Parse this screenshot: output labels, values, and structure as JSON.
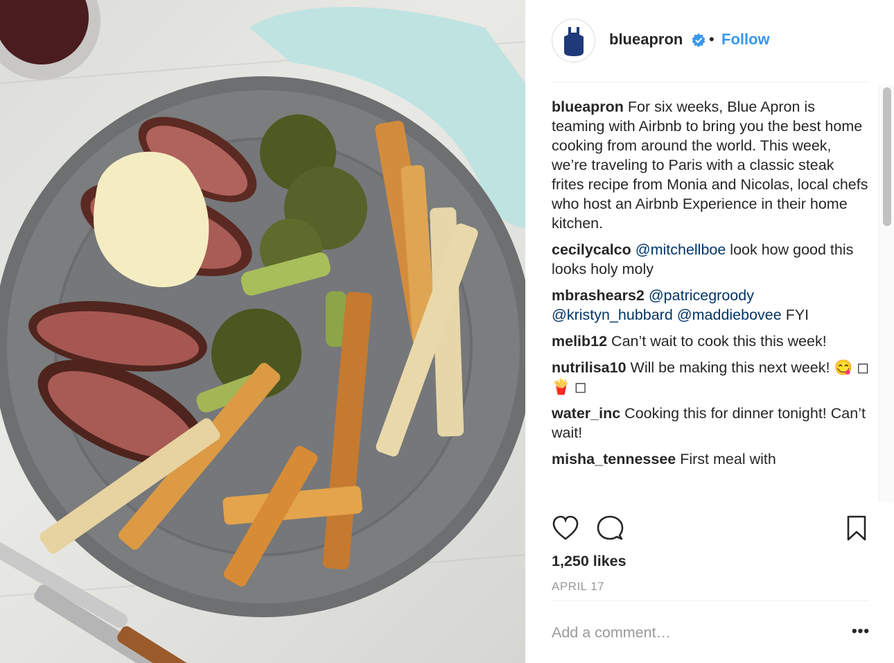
{
  "post": {
    "handle": "blueapron",
    "follow_label": "Follow",
    "separator": "•",
    "brand_color": "#1e3a78",
    "verified_color": "#3897f0"
  },
  "comments": [
    {
      "user": "blueapron",
      "parts": [
        {
          "text": " For six weeks, Blue Apron is teaming with Airbnb to bring you the best home cooking from around the world. This week, we’re traveling to Paris with a classic steak frites recipe from Monia and Nicolas, local chefs who host an Airbnb Experience in their home kitchen.",
          "mention": false
        }
      ]
    },
    {
      "user": "cecilycalco",
      "parts": [
        {
          "text": " ",
          "mention": false
        },
        {
          "text": "@mitchellboe",
          "mention": true
        },
        {
          "text": " look how good this looks holy moly",
          "mention": false
        }
      ]
    },
    {
      "user": "mbrashears2",
      "parts": [
        {
          "text": " ",
          "mention": false
        },
        {
          "text": "@patricegroody",
          "mention": true
        },
        {
          "text": " ",
          "mention": false
        },
        {
          "text": "@kristyn_hubbard",
          "mention": true
        },
        {
          "text": " ",
          "mention": false
        },
        {
          "text": "@maddiebovee",
          "mention": true
        },
        {
          "text": " FYI",
          "mention": false
        }
      ]
    },
    {
      "user": "melib12",
      "parts": [
        {
          "text": " Can’t wait to cook this this week!",
          "mention": false
        }
      ]
    },
    {
      "user": "nutrilisa10",
      "parts": [
        {
          "text": " Will be making this next week! 😋 ◻🍟 ◻",
          "mention": false
        }
      ]
    },
    {
      "user": "water_inc",
      "parts": [
        {
          "text": " Cooking this for dinner tonight! Can’t wait!",
          "mention": false
        }
      ]
    },
    {
      "user": "misha_tennessee",
      "parts": [
        {
          "text": " First meal with",
          "mention": false
        }
      ]
    }
  ],
  "likes": "1,250 likes",
  "date": "APRIL 17",
  "add_comment_placeholder": "Add a comment…",
  "more_label": "•••"
}
